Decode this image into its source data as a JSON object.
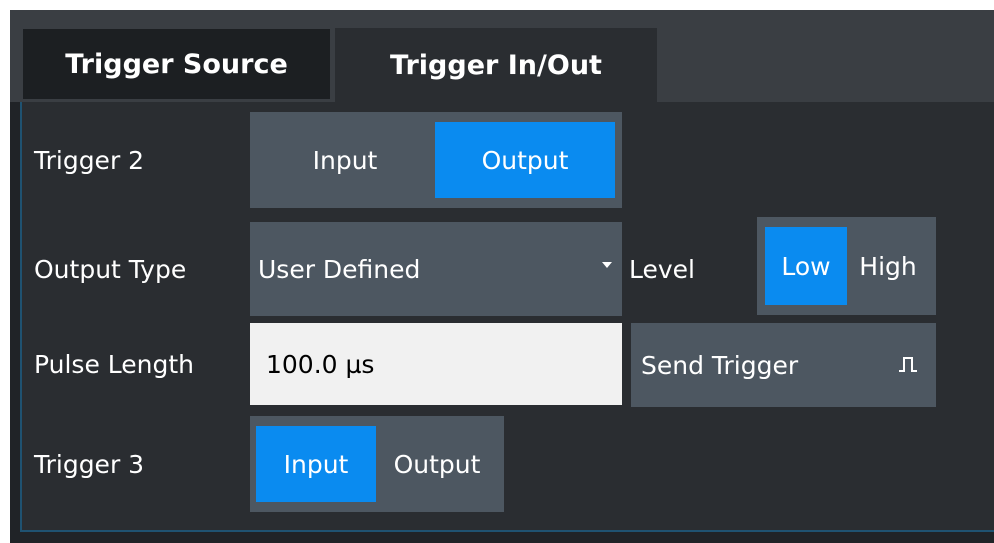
{
  "tabs": [
    {
      "label": "Trigger Source",
      "active": false
    },
    {
      "label": "Trigger In/Out",
      "active": true
    }
  ],
  "trigger2": {
    "label": "Trigger 2",
    "options": [
      "Input",
      "Output"
    ],
    "selected": "Output"
  },
  "output_type": {
    "label": "Output Type",
    "value": "User Defined",
    "icon": "dropdown-arrow-icon"
  },
  "level": {
    "label": "Level",
    "options": [
      "Low",
      "High"
    ],
    "selected": "Low"
  },
  "pulse_length": {
    "label": "Pulse Length",
    "value": "100.0 µs"
  },
  "send_trigger": {
    "label": "Send Trigger",
    "icon": "pulse-icon"
  },
  "trigger3": {
    "label": "Trigger 3",
    "options": [
      "Input",
      "Output"
    ],
    "selected": "Input"
  },
  "colors": {
    "accent": "#0a8bf0",
    "control_bg": "#4d5761",
    "panel_bg": "#2a2d31"
  }
}
